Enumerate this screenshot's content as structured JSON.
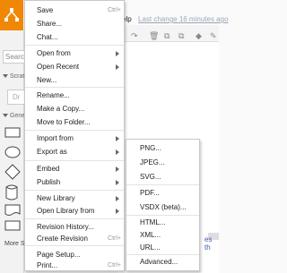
{
  "app": {
    "brand_color": "#f08705",
    "logo_icon": "drawio-logo-icon"
  },
  "sidebar": {
    "search_placeholder": "Search",
    "section_scratchpad": "Scratch",
    "section_general": "General",
    "ghost_button": "Dr",
    "more_shapes": "More S"
  },
  "header": {
    "help": "elp",
    "last_change": "Last change 16 minutes ago"
  },
  "canvas": {
    "partial_text": "es th"
  },
  "menu": {
    "items": [
      {
        "label": "Save",
        "shortcut": "Ctrl+"
      },
      {
        "label": "Share..."
      },
      {
        "label": "Chat..."
      },
      {
        "label": "Open from"
      },
      {
        "label": "Open Recent"
      },
      {
        "label": "New..."
      },
      {
        "label": "Rename..."
      },
      {
        "label": "Make a Copy..."
      },
      {
        "label": "Move to Folder..."
      },
      {
        "label": "Import from"
      },
      {
        "label": "Export as"
      },
      {
        "label": "Embed"
      },
      {
        "label": "Publish"
      },
      {
        "label": "New Library"
      },
      {
        "label": "Open Library from"
      },
      {
        "label": "Revision History..."
      },
      {
        "label": "Create Revision",
        "shortcut": "Ctrl+"
      },
      {
        "label": "Page Setup..."
      },
      {
        "label": "Print...",
        "shortcut": "Ctrl+"
      }
    ]
  },
  "submenu": {
    "items": [
      {
        "label": "PNG..."
      },
      {
        "label": "JPEG..."
      },
      {
        "label": "SVG..."
      },
      {
        "label": "PDF..."
      },
      {
        "label": "VSDX (beta)..."
      },
      {
        "label": "HTML..."
      },
      {
        "label": "XML..."
      },
      {
        "label": "URL..."
      },
      {
        "label": "Advanced..."
      }
    ]
  }
}
